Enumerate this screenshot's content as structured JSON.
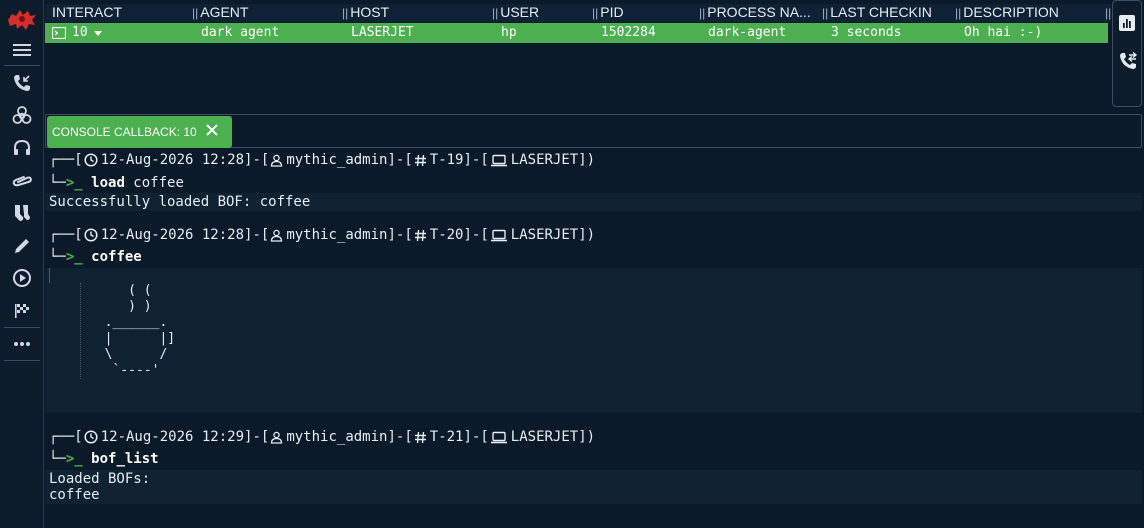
{
  "sidebar": {
    "items": [
      {
        "name": "mythic-logo"
      },
      {
        "name": "menu-icon"
      },
      {
        "name": "callbacks-phone-icon"
      },
      {
        "name": "payloads-biohazard-icon"
      },
      {
        "name": "headphones-icon"
      },
      {
        "name": "paperclip-icon"
      },
      {
        "name": "socks-icon"
      },
      {
        "name": "pencil-icon"
      },
      {
        "name": "play-icon"
      },
      {
        "name": "flag-icon"
      },
      {
        "name": "more-icon"
      }
    ]
  },
  "table": {
    "headers": [
      "INTERACT",
      "AGENT",
      "HOST",
      "USER",
      "PID",
      "PROCESS NA...",
      "LAST CHECKIN",
      "DESCRIPTION"
    ],
    "row": {
      "interact": "10",
      "agent": "dark agent",
      "host": "LASERJET",
      "user": "hp",
      "pid": "1502284",
      "process": "dark-agent",
      "last_checkin": "3 seconds",
      "description": "Oh hai :-)"
    }
  },
  "console_tab": {
    "label": "CONSOLE CALLBACK: 10"
  },
  "console": {
    "tasks": [
      {
        "date": "12-Aug-2026 12:28",
        "user": "mythic_admin",
        "task": "T-19",
        "host": "LASERJET",
        "command": "load",
        "args": " coffee",
        "output": "Successfully loaded BOF: coffee"
      },
      {
        "date": "12-Aug-2026 12:28",
        "user": "mythic_admin",
        "task": "T-20",
        "host": "LASERJET",
        "command": "coffee",
        "args": "",
        "output": "     ( (\n     ) )\n  .______.\n  |      |]\n  \\      /\n   `----'"
      },
      {
        "date": "12-Aug-2026 12:29",
        "user": "mythic_admin",
        "task": "T-21",
        "host": "LASERJET",
        "command": "bof_list",
        "args": "",
        "output": "Loaded BOFs:\ncoffee"
      }
    ]
  },
  "colors": {
    "accent_green": "#4caf50",
    "background": "#0b1a28",
    "logo_red": "#d32f2f"
  }
}
